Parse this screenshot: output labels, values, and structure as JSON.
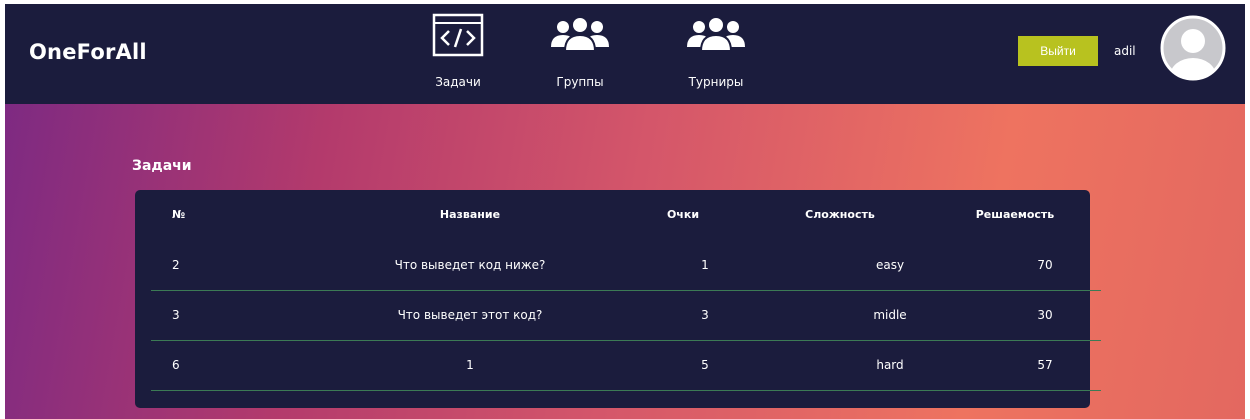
{
  "app": {
    "logo": "OneForAll"
  },
  "nav": [
    {
      "label": "Задачи",
      "icon": "code-window-icon"
    },
    {
      "label": "Группы",
      "icon": "users-group-icon"
    },
    {
      "label": "Турниры",
      "icon": "users-group-icon"
    }
  ],
  "header": {
    "logout_label": "Выйти",
    "username": "adil",
    "avatar_icon": "user-avatar-icon"
  },
  "colors": {
    "topbar": "#1b1c3d",
    "card": "#1b1c3d",
    "logout_button": "#b8c21f",
    "row_divider": "#3c7a55",
    "gradient_start": "#7e2a82",
    "gradient_end": "#ee7360"
  },
  "page": {
    "title": "Задачи",
    "columns": [
      "№",
      "Название",
      "Очки",
      "Сложность",
      "Решаемость"
    ],
    "rows": [
      {
        "num": "2",
        "name": "Что выведет код ниже?",
        "points": "1",
        "difficulty": "easy",
        "solvability": "70"
      },
      {
        "num": "3",
        "name": "Что выведет этот код?",
        "points": "3",
        "difficulty": "midle",
        "solvability": "30"
      },
      {
        "num": "6",
        "name": "1",
        "points": "5",
        "difficulty": "hard",
        "solvability": "57"
      }
    ]
  }
}
